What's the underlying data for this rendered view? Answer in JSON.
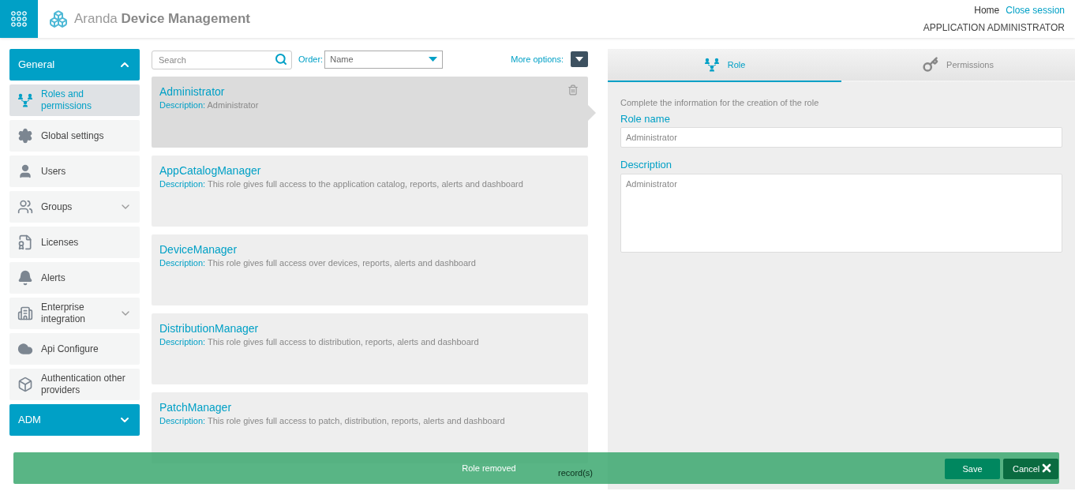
{
  "header": {
    "brand_light": "Aranda",
    "brand_bold": "Device Management",
    "links": [
      {
        "label": "Home",
        "kind": "plain"
      },
      {
        "label": "Close session",
        "kind": "link"
      }
    ],
    "user_role": "APPLICATION ADMINISTRATOR"
  },
  "sidebar": {
    "sections": [
      {
        "label": "General",
        "expanded": true,
        "items": [
          {
            "label": "Roles and permissions",
            "selected": true,
            "has_submenu": false
          },
          {
            "label": "Global settings",
            "selected": false,
            "has_submenu": false
          },
          {
            "label": "Users",
            "selected": false,
            "has_submenu": false
          },
          {
            "label": "Groups",
            "selected": false,
            "has_submenu": true
          },
          {
            "label": "Licenses",
            "selected": false,
            "has_submenu": false
          },
          {
            "label": "Alerts",
            "selected": false,
            "has_submenu": false
          },
          {
            "label": "Enterprise integration",
            "selected": false,
            "has_submenu": true
          },
          {
            "label": "Api Configure",
            "selected": false,
            "has_submenu": false
          },
          {
            "label": "Authentication other providers",
            "selected": false,
            "has_submenu": false
          }
        ]
      },
      {
        "label": "ADM",
        "expanded": false
      }
    ]
  },
  "toolbar": {
    "search": {
      "placeholder": "Search"
    },
    "order_label": "Order:",
    "order_value": "Name",
    "more_options": "More options:"
  },
  "roles": [
    {
      "name": "Administrator",
      "description_label": "Description:",
      "description": "Administrator",
      "selected": true
    },
    {
      "name": "AppCatalogManager",
      "description_label": "Description:",
      "description": "This role gives full access to the application catalog, reports, alerts and dashboard",
      "selected": false
    },
    {
      "name": "DeviceManager",
      "description_label": "Description:",
      "description": "This role gives full access over devices, reports, alerts and dashboard",
      "selected": false
    },
    {
      "name": "DistributionManager",
      "description_label": "Description:",
      "description": "This role gives full access to distribution, reports, alerts and dashboard",
      "selected": false
    },
    {
      "name": "PatchManager",
      "description_label": "Description:",
      "description": "This role gives full access to patch, distribution, reports, alerts and dashboard",
      "selected": false
    }
  ],
  "records": "record(s)",
  "detail": {
    "tabs": [
      {
        "label": "Role",
        "selected": true
      },
      {
        "label": "Permissions",
        "selected": false
      }
    ],
    "intro": "Complete the information for the creation of the role",
    "role_name": {
      "label": "Role name",
      "value": "Administrator"
    },
    "description": {
      "label": "Description",
      "value": "Administrator"
    },
    "buttons": [
      "Save",
      "Cancel"
    ]
  },
  "toast": {
    "message": "Role removed"
  }
}
